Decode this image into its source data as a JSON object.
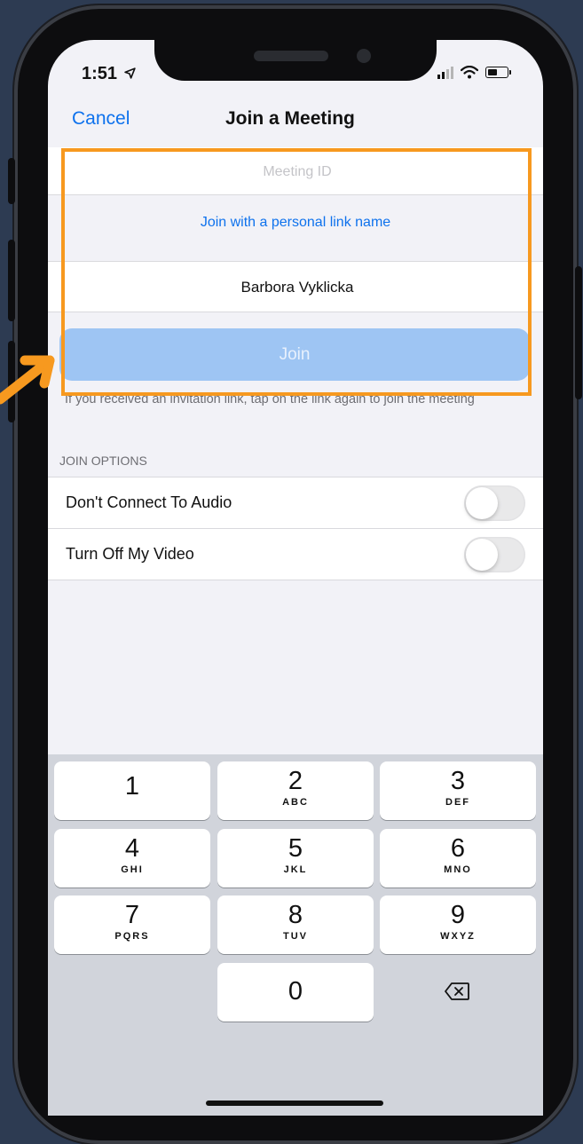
{
  "status_bar": {
    "time": "1:51"
  },
  "header": {
    "cancel_label": "Cancel",
    "title": "Join a Meeting"
  },
  "form": {
    "meeting_id_placeholder": "Meeting ID",
    "personal_link_label": "Join with a personal link name",
    "name_value": "Barbora Vyklicka",
    "join_label": "Join",
    "hint": "If you received an invitation link, tap on the link again to join the meeting"
  },
  "options": {
    "section_label": "JOIN OPTIONS",
    "items": [
      {
        "label": "Don't Connect To Audio",
        "on": false
      },
      {
        "label": "Turn Off My Video",
        "on": false
      }
    ]
  },
  "keypad": {
    "keys": [
      {
        "num": "1",
        "letters": ""
      },
      {
        "num": "2",
        "letters": "ABC"
      },
      {
        "num": "3",
        "letters": "DEF"
      },
      {
        "num": "4",
        "letters": "GHI"
      },
      {
        "num": "5",
        "letters": "JKL"
      },
      {
        "num": "6",
        "letters": "MNO"
      },
      {
        "num": "7",
        "letters": "PQRS"
      },
      {
        "num": "8",
        "letters": "TUV"
      },
      {
        "num": "9",
        "letters": "WXYZ"
      },
      {
        "num": "0",
        "letters": ""
      }
    ]
  },
  "colors": {
    "accent": "#0e72ed",
    "highlight": "#f7991f",
    "join_disabled": "#9ec5f3"
  }
}
